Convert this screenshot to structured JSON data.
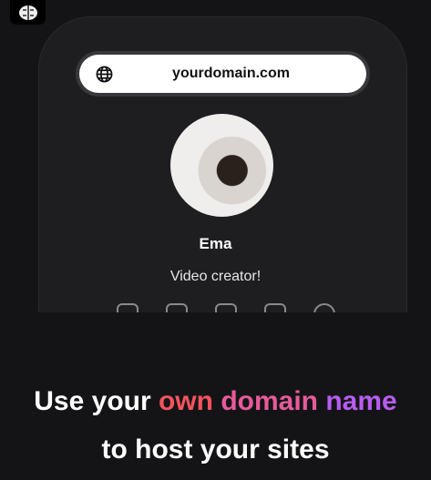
{
  "url_bar": {
    "domain": "yourdomain.com"
  },
  "profile": {
    "name": "Ema",
    "bio": "Video creator!"
  },
  "socials": [
    "twitter-icon",
    "instagram-icon",
    "tiktok-icon",
    "youtube-icon",
    "spotify-icon"
  ],
  "headline": {
    "part1": "Use your ",
    "own": "own",
    "space1": " ",
    "domain": "domain",
    "space2": " ",
    "name": "name",
    "line2": "to host your sites"
  },
  "colors": {
    "own": "#f4535d",
    "domain": "#e85a9a",
    "name": "#b85cf2"
  }
}
